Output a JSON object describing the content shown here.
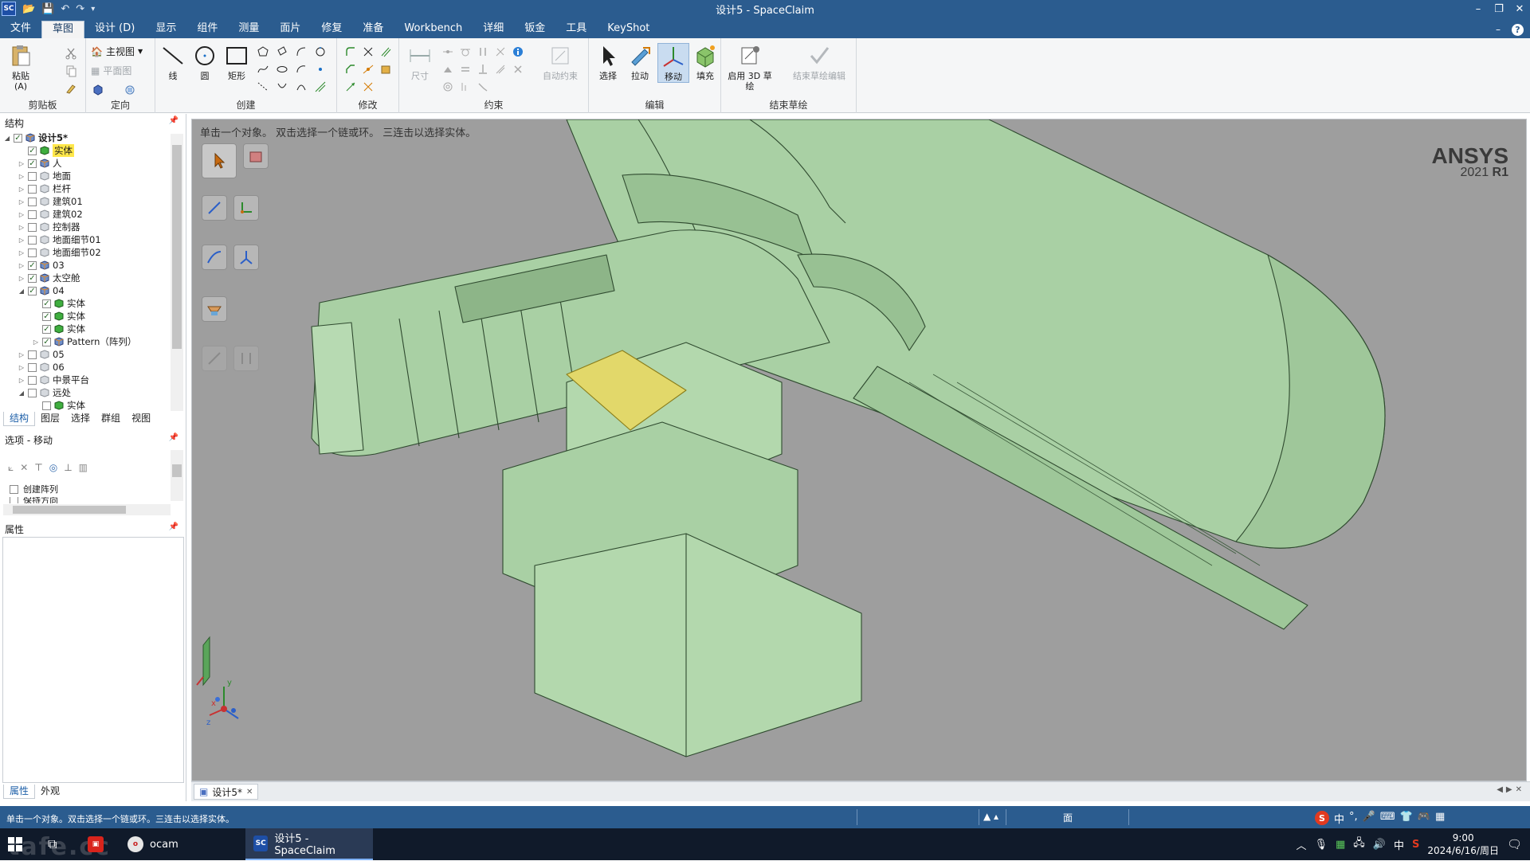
{
  "window": {
    "title": "设计5 - SpaceClaim",
    "logo_text": "SC",
    "controls": [
      "–",
      "❐",
      "✕"
    ]
  },
  "menu": {
    "items": [
      "文件",
      "草图",
      "设计 (D)",
      "显示",
      "组件",
      "测量",
      "面片",
      "修复",
      "准备",
      "Workbench",
      "详细",
      "钣金",
      "工具",
      "KeyShot"
    ],
    "active_index": 1,
    "right_minimize": "–",
    "help": "?"
  },
  "ribbon": {
    "clipboard": {
      "paste": "粘贴 (A)",
      "group": "剪贴板"
    },
    "orient": {
      "home_view": "主视图",
      "plan_view": "平面图",
      "group": "定向"
    },
    "create": {
      "line": "线",
      "circle": "圆",
      "rect": "矩形",
      "group": "创建"
    },
    "modify": {
      "group": "修改"
    },
    "constraint": {
      "dimension": "尺寸",
      "auto": "自动约束",
      "group": "约束"
    },
    "edit": {
      "select": "选择",
      "pull": "拉动",
      "move": "移动",
      "fill": "填充",
      "group": "编辑"
    },
    "end": {
      "enable3d": "启用 3D 草绘",
      "end_edit": "结束草绘编辑",
      "group": "结束草绘"
    }
  },
  "structure": {
    "header": "结构",
    "tree": [
      {
        "label": "设计5*",
        "level": 0,
        "expanded": true,
        "checked": true,
        "bold": true
      },
      {
        "label": "实体",
        "level": 1,
        "expanded": null,
        "checked": true,
        "highlight": true
      },
      {
        "label": "人",
        "level": 1,
        "expanded": false,
        "checked": true
      },
      {
        "label": "地面",
        "level": 1,
        "expanded": false,
        "checked": false
      },
      {
        "label": "栏杆",
        "level": 1,
        "expanded": false,
        "checked": false
      },
      {
        "label": "建筑01",
        "level": 1,
        "expanded": false,
        "checked": false
      },
      {
        "label": "建筑02",
        "level": 1,
        "expanded": false,
        "checked": false
      },
      {
        "label": "控制器",
        "level": 1,
        "expanded": false,
        "checked": false
      },
      {
        "label": "地面细节01",
        "level": 1,
        "expanded": false,
        "checked": false
      },
      {
        "label": "地面细节02",
        "level": 1,
        "expanded": false,
        "checked": false
      },
      {
        "label": "03",
        "level": 1,
        "expanded": false,
        "checked": true
      },
      {
        "label": "太空舱",
        "level": 1,
        "expanded": false,
        "checked": true
      },
      {
        "label": "04",
        "level": 1,
        "expanded": true,
        "checked": true
      },
      {
        "label": "实体",
        "level": 2,
        "expanded": null,
        "checked": true
      },
      {
        "label": "实体",
        "level": 2,
        "expanded": null,
        "checked": true
      },
      {
        "label": "实体",
        "level": 2,
        "expanded": null,
        "checked": true
      },
      {
        "label": "Pattern（阵列）",
        "level": 2,
        "expanded": false,
        "checked": true
      },
      {
        "label": "05",
        "level": 1,
        "expanded": false,
        "checked": false
      },
      {
        "label": "06",
        "level": 1,
        "expanded": false,
        "checked": false
      },
      {
        "label": "中景平台",
        "level": 1,
        "expanded": false,
        "checked": false
      },
      {
        "label": "远处",
        "level": 1,
        "expanded": true,
        "checked": false
      },
      {
        "label": "实体",
        "level": 2,
        "expanded": null,
        "checked": false
      }
    ],
    "tabs": [
      "结构",
      "图层",
      "选择",
      "群组",
      "视图"
    ],
    "active_tab": 0
  },
  "options": {
    "header": "选项 - 移动",
    "create_array": "创建阵列",
    "keep_direction": "保持方向"
  },
  "properties": {
    "header": "属性",
    "tabs": [
      "属性",
      "外观"
    ]
  },
  "viewport": {
    "hint": "单击一个对象。 双击选择一个链或环。 三连击以选择实体。",
    "brand": "ANSYS",
    "version_year": "2021",
    "version_release": "R1",
    "model_color": "#a8cfa3",
    "highlight_color": "#e2d86a",
    "axis_x": "x",
    "axis_y": "y",
    "axis_z": "z"
  },
  "doc_tabs": [
    {
      "label": "设计5*",
      "close": "✕"
    }
  ],
  "statusbar": {
    "message": "单击一个对象。双击选择一个链或环。三连击以选择实体。",
    "mode_icon": "▲ ▴",
    "face_label": "面"
  },
  "taskbar": {
    "watermark": "tafe.cc",
    "apps": [
      {
        "label": "ocam",
        "icon_text": "o"
      },
      {
        "label": "设计5 - SpaceClaim",
        "icon_text": "SC"
      }
    ],
    "tray_ime": "中",
    "time": "9:00",
    "date": "2024/6/16/周日"
  }
}
